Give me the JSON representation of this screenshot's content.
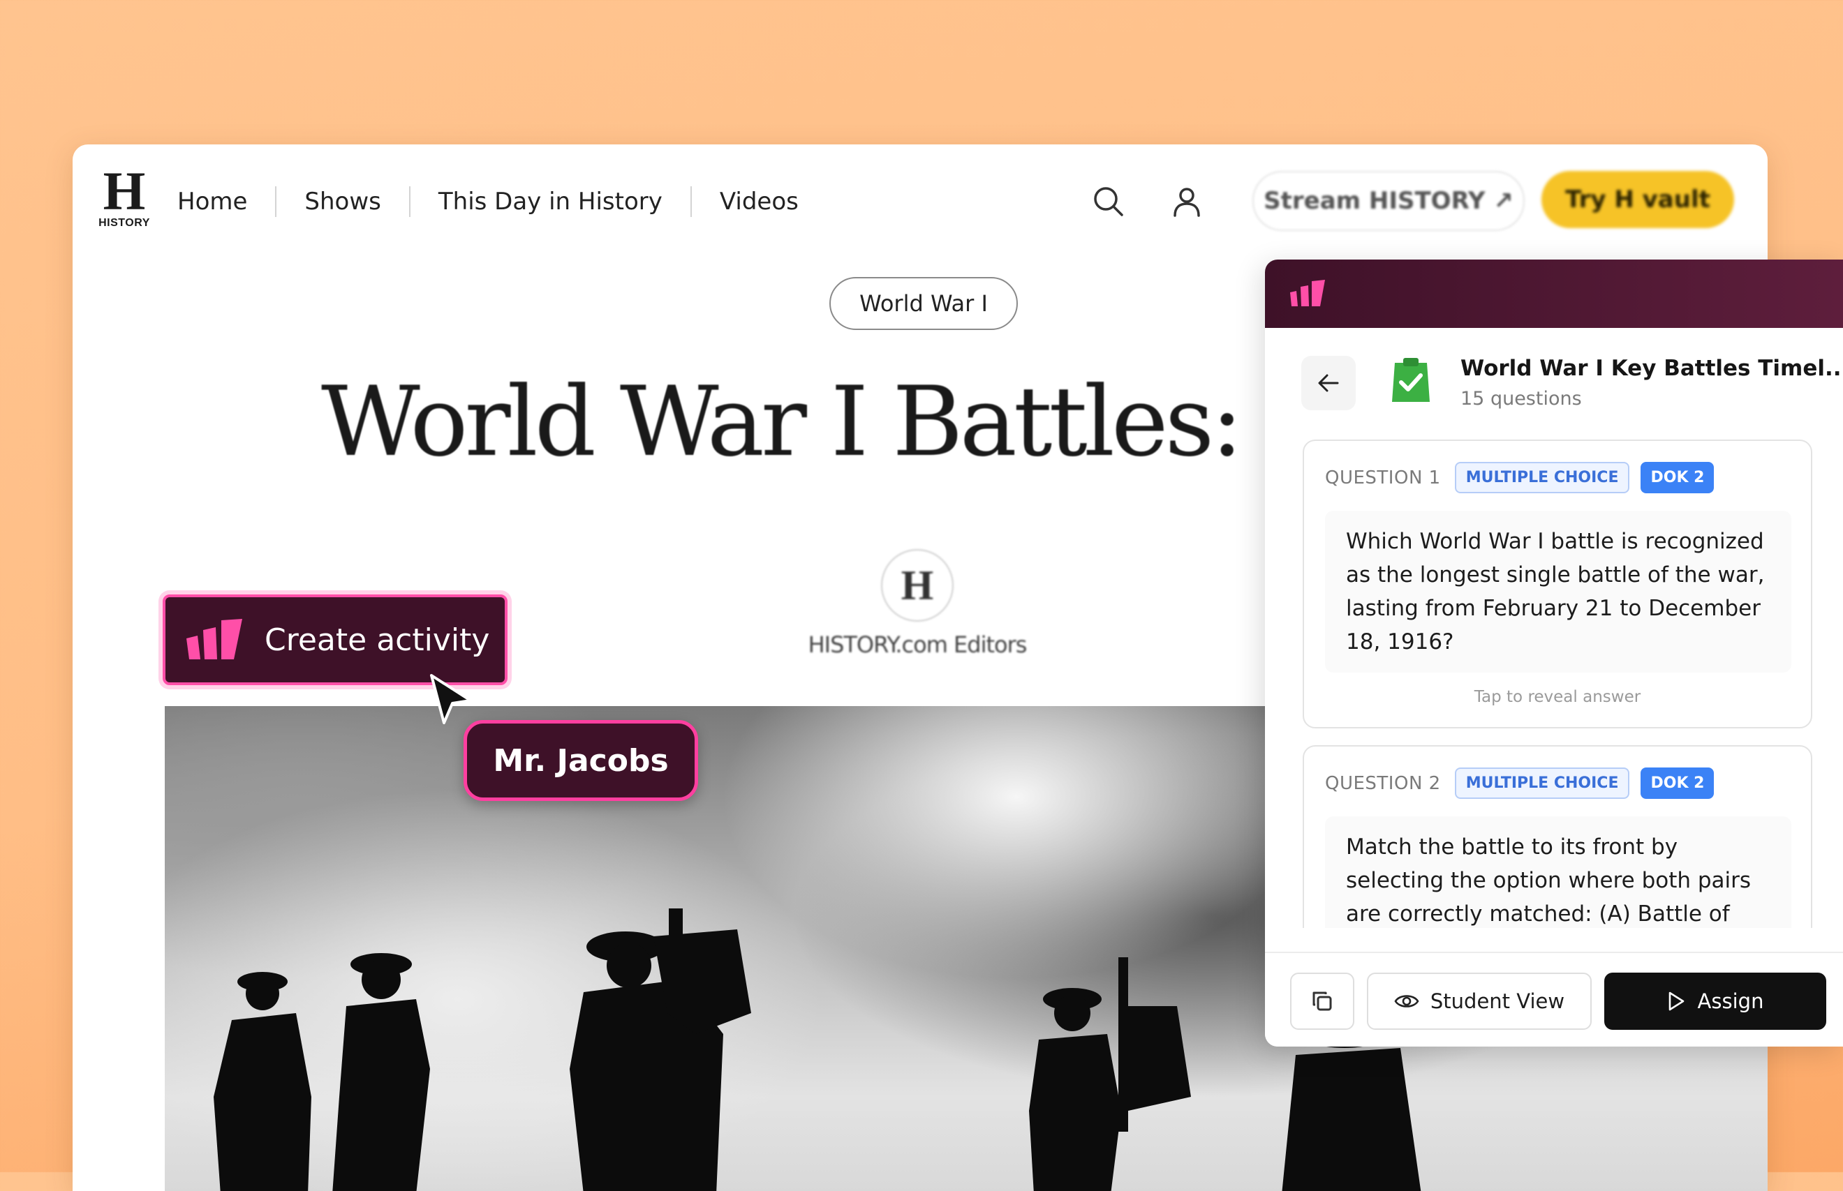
{
  "brand": {
    "logo_letter": "H",
    "logo_text": "HISTORY"
  },
  "nav": {
    "items": [
      {
        "label": "Home"
      },
      {
        "label": "Shows"
      },
      {
        "label": "This Day in History"
      },
      {
        "label": "Videos"
      }
    ],
    "stream_label": "Stream HISTORY ↗",
    "try_label": "Try H vault"
  },
  "article": {
    "tag": "World War I",
    "headline": "World War I Battles: Timeline",
    "author_initial": "H",
    "author_name": "HISTORY.com Editors"
  },
  "overlay": {
    "create_activity_label": "Create activity",
    "user_name": "Mr. Jacobs"
  },
  "panel": {
    "title": "World War I Key Battles Timel...",
    "question_count": "15 questions",
    "questions": [
      {
        "number": "QUESTION 1",
        "type": "MULTIPLE CHOICE",
        "dok": "DOK 2",
        "text": "Which World War I battle is recognized as the longest single battle of the war, lasting from February 21 to December 18, 1916?",
        "reveal": "Tap to reveal answer"
      },
      {
        "number": "QUESTION 2",
        "type": "MULTIPLE CHOICE",
        "dok": "DOK 2",
        "text": "Match the battle to its front by selecting the option where both pairs are correctly matched: (A) Battle of"
      }
    ],
    "student_view_label": "Student View",
    "assign_label": "Assign"
  },
  "colors": {
    "background": "#ffbe86",
    "panel_header": "#3e1128",
    "accent_pink": "#ff4fa8",
    "try_yellow": "#f6c327",
    "badge_blue": "#3b82f6",
    "clipboard_green": "#3cb043"
  },
  "icons": [
    "history-logo",
    "search-icon",
    "user-icon",
    "brand-bars-icon",
    "back-arrow-icon",
    "clipboard-check-icon",
    "copy-icon",
    "eye-icon",
    "play-icon",
    "cursor-icon"
  ]
}
